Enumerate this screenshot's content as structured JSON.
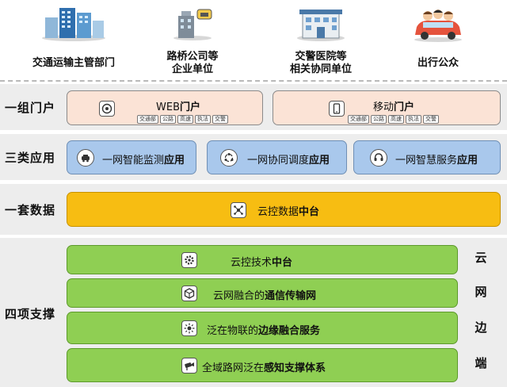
{
  "stakeholders": [
    {
      "label_lines": [
        "交通运输主管部门"
      ],
      "icon": "office-building-icon"
    },
    {
      "label_lines": [
        "路桥公司等",
        "企业单位"
      ],
      "icon": "company-tower-icon"
    },
    {
      "label_lines": [
        "交警医院等",
        "相关协同单位"
      ],
      "icon": "hospital-building-icon"
    },
    {
      "label_lines": [
        "出行公众"
      ],
      "icon": "family-car-icon"
    }
  ],
  "layers": {
    "portal": {
      "label": "一组门户",
      "items": [
        {
          "text_plain": "WEB",
          "text_bold": "门户",
          "icon": "web-portal-icon",
          "tags": [
            "交通部",
            "公路",
            "高速",
            "执法",
            "交警"
          ]
        },
        {
          "text_plain": "移动",
          "text_bold": "门户",
          "icon": "mobile-phone-icon",
          "tags": [
            "交通部",
            "公路",
            "高速",
            "执法",
            "交警"
          ]
        }
      ]
    },
    "apps": {
      "label": "三类应用",
      "items": [
        {
          "text_plain": "一网智能监测",
          "text_bold": "应用",
          "icon": "vehicle-monitor-icon"
        },
        {
          "text_plain": "一网协同调度",
          "text_bold": "应用",
          "icon": "cycle-dispatch-icon"
        },
        {
          "text_plain": "一网智慧服务",
          "text_bold": "应用",
          "icon": "service-headset-icon"
        }
      ]
    },
    "data": {
      "label": "一套数据",
      "item": {
        "text_plain": "云控数据",
        "text_bold": "中台",
        "icon": "data-hub-icon"
      }
    },
    "support": {
      "label": "四项支撑",
      "items": [
        {
          "text_plain": "云控技术",
          "text_bold": "中台",
          "text_after": "",
          "icon": "gear-icon"
        },
        {
          "text_plain": "云网融合的",
          "text_bold": "通信传输网",
          "text_after": "",
          "icon": "network-cube-icon"
        },
        {
          "text_plain": "泛在物联的",
          "text_bold": "边缘融合服务",
          "text_after": "",
          "icon": "edge-sun-icon"
        },
        {
          "text_plain": "全域路网泛在",
          "text_bold": "感知支撑体系",
          "text_after": "",
          "icon": "camera-sensor-icon"
        }
      ],
      "side_chars": [
        "云",
        "网",
        "边",
        "端"
      ]
    }
  }
}
